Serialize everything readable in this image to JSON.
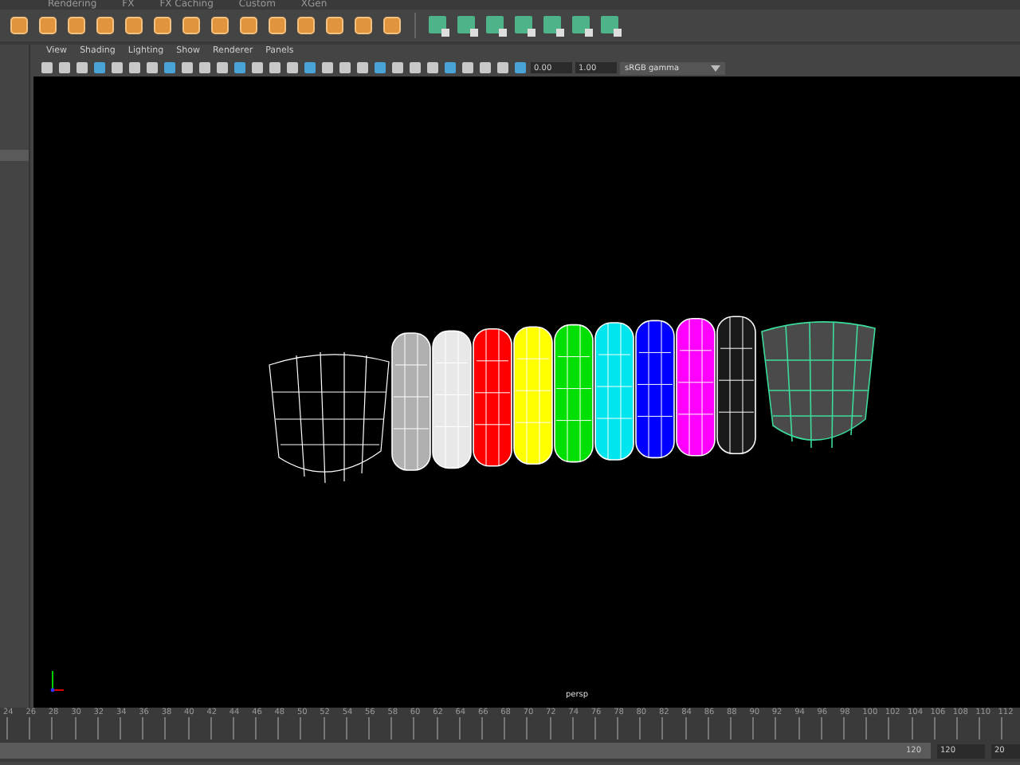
{
  "shelf": {
    "tabs": [
      {
        "label": "Rendering"
      },
      {
        "label": "FX"
      },
      {
        "label": "FX Caching"
      },
      {
        "label": "Custom"
      },
      {
        "label": "XGen"
      }
    ]
  },
  "panel": {
    "menu": [
      "View",
      "Shading",
      "Lighting",
      "Show",
      "Renderer",
      "Panels"
    ],
    "exposure": "0.00",
    "gamma": "1.00",
    "color_space": "sRGB gamma"
  },
  "viewport": {
    "camera": "persp",
    "rings": [
      {
        "color": "#b0b0b0"
      },
      {
        "color": "#e8e8e8"
      },
      {
        "color": "#ff0000"
      },
      {
        "color": "#ffff00"
      },
      {
        "color": "#00e000"
      },
      {
        "color": "#00e5ee"
      },
      {
        "color": "#0000ff"
      },
      {
        "color": "#ff00ff"
      },
      {
        "color": "#1a1a1a"
      }
    ]
  },
  "timeline": {
    "ticks": [
      "24",
      "26",
      "28",
      "30",
      "32",
      "34",
      "36",
      "38",
      "40",
      "42",
      "44",
      "46",
      "48",
      "50",
      "52",
      "54",
      "56",
      "58",
      "60",
      "62",
      "64",
      "66",
      "68",
      "70",
      "72",
      "74",
      "76",
      "78",
      "80",
      "82",
      "84",
      "86",
      "88",
      "90",
      "92",
      "94",
      "96",
      "98",
      "100",
      "102",
      "104",
      "106",
      "108",
      "110",
      "112"
    ]
  },
  "range": {
    "level": 1,
    "slider_end": "120",
    "end_field": "120",
    "max_field": "20"
  }
}
